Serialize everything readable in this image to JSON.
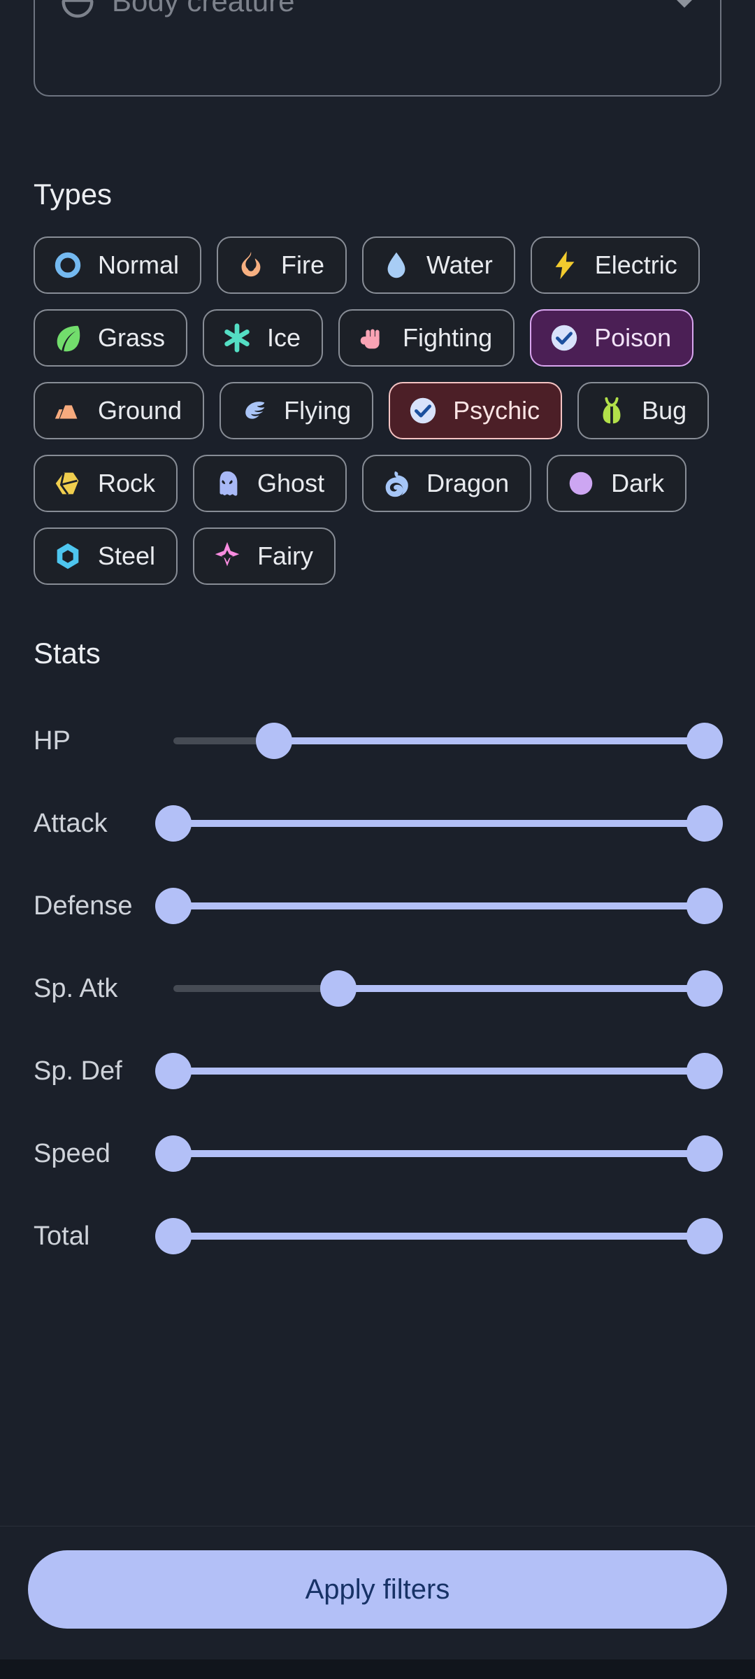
{
  "theme": {
    "background": "#1b202a",
    "chip_bg": "#1c2027",
    "chip_border": "#888d96",
    "accent": "#b3c0f7",
    "poison_bg": "#4b1f55",
    "poison_border": "#d9a6ef",
    "psychic_bg": "#4c1f27",
    "psychic_border": "#f4c3c3",
    "track_inactive": "#464b54"
  },
  "dropdown": {
    "placeholder": "Body creature",
    "icon": "body-creature-icon",
    "chevron": "chevron-down-icon"
  },
  "types_section": {
    "title": "Types",
    "chips": [
      {
        "label": "Normal",
        "icon": "normal-type-icon",
        "color": "#74b9f0",
        "selected": false
      },
      {
        "label": "Fire",
        "icon": "fire-type-icon",
        "color": "#f7b081",
        "selected": false
      },
      {
        "label": "Water",
        "icon": "water-type-icon",
        "color": "#a8cdf5",
        "selected": false
      },
      {
        "label": "Electric",
        "icon": "electric-type-icon",
        "color": "#f2cb2e",
        "selected": false
      },
      {
        "label": "Grass",
        "icon": "grass-type-icon",
        "color": "#72dd6c",
        "selected": false
      },
      {
        "label": "Ice",
        "icon": "ice-type-icon",
        "color": "#54dec4",
        "selected": false
      },
      {
        "label": "Fighting",
        "icon": "fighting-type-icon",
        "color": "#f9a3b4",
        "selected": false
      },
      {
        "label": "Poison",
        "icon": "check-circle-icon",
        "color": "#d5e0fb",
        "selected": true
      },
      {
        "label": "Ground",
        "icon": "ground-type-icon",
        "color": "#f7ab7e",
        "selected": false
      },
      {
        "label": "Flying",
        "icon": "flying-type-icon",
        "color": "#aac5f7",
        "selected": false
      },
      {
        "label": "Psychic",
        "icon": "check-circle-icon",
        "color": "#d5e0fb",
        "selected": true
      },
      {
        "label": "Bug",
        "icon": "bug-type-icon",
        "color": "#b2e04a",
        "selected": false
      },
      {
        "label": "Rock",
        "icon": "rock-type-icon",
        "color": "#f0ce4e",
        "selected": false
      },
      {
        "label": "Ghost",
        "icon": "ghost-type-icon",
        "color": "#a9b9f7",
        "selected": false
      },
      {
        "label": "Dragon",
        "icon": "dragon-type-icon",
        "color": "#a6c6f7",
        "selected": false
      },
      {
        "label": "Dark",
        "icon": "dark-type-icon",
        "color": "#cda6f2",
        "selected": false
      },
      {
        "label": "Steel",
        "icon": "steel-type-icon",
        "color": "#4ec6ef",
        "selected": false
      },
      {
        "label": "Fairy",
        "icon": "fairy-type-icon",
        "color": "#f98ce0",
        "selected": false
      }
    ]
  },
  "stats_section": {
    "title": "Stats",
    "sliders": [
      {
        "label": "HP",
        "low_pct": 19,
        "high_pct": 100
      },
      {
        "label": "Attack",
        "low_pct": 0,
        "high_pct": 100
      },
      {
        "label": "Defense",
        "low_pct": 0,
        "high_pct": 100
      },
      {
        "label": "Sp. Atk",
        "low_pct": 31,
        "high_pct": 100
      },
      {
        "label": "Sp. Def",
        "low_pct": 0,
        "high_pct": 100
      },
      {
        "label": "Speed",
        "low_pct": 0,
        "high_pct": 100
      },
      {
        "label": "Total",
        "low_pct": 0,
        "high_pct": 100
      }
    ]
  },
  "footer": {
    "apply_label": "Apply filters"
  }
}
